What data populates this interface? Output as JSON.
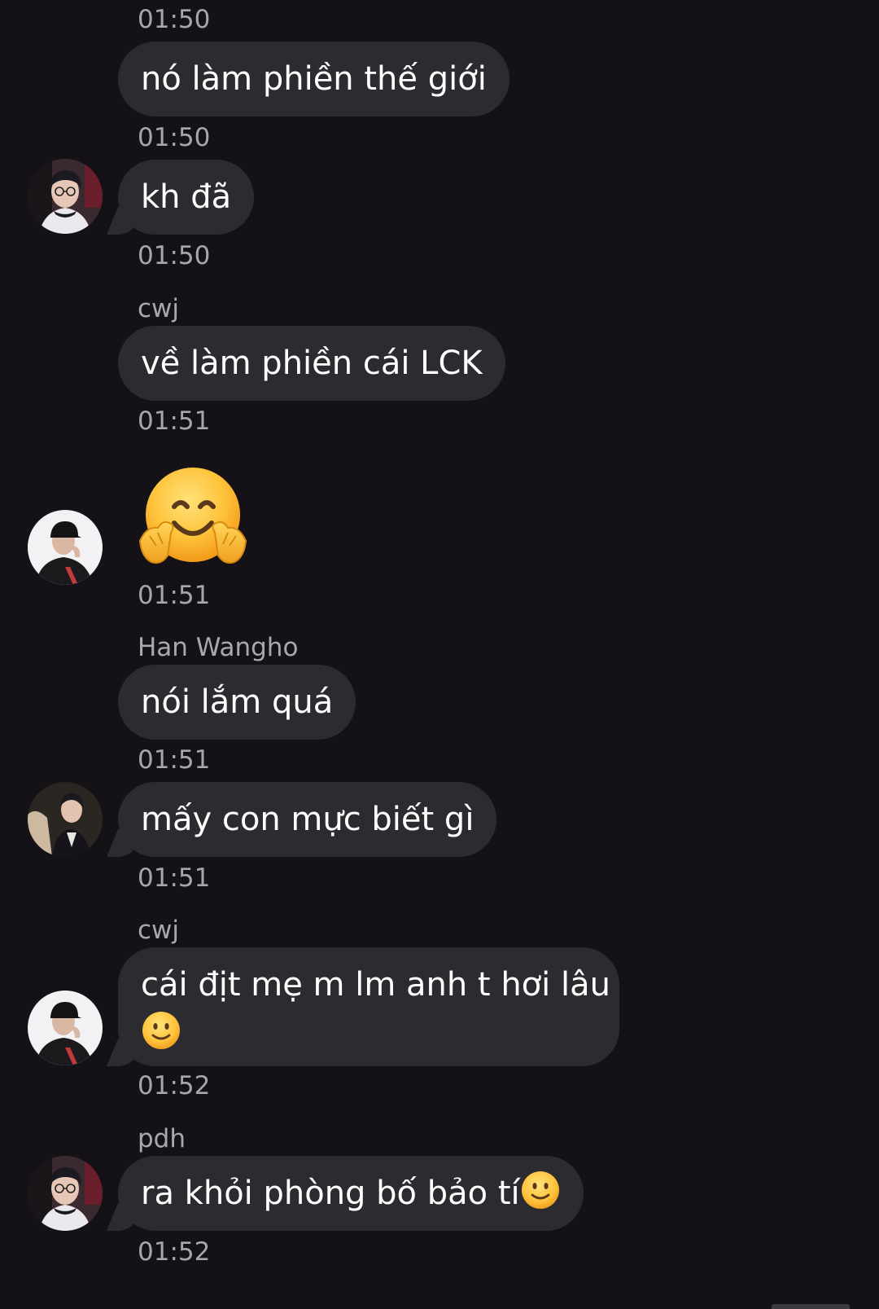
{
  "messages": [
    {
      "time": "01:50"
    },
    {
      "text": "nó làm phiền thế giới",
      "time": "01:50"
    },
    {
      "text": "kh đã",
      "time": "01:50",
      "avatar": "avatar-glasses"
    },
    {
      "sender": "cwj",
      "text": "về làm phiền cái LCK",
      "time": "01:51"
    },
    {
      "emoji": "hugging-face-emoji",
      "time": "01:51",
      "avatar": "avatar-cap"
    },
    {
      "sender": "Han Wangho",
      "text": "nói lắm quá",
      "time": "01:51"
    },
    {
      "text": "mấy con mực biết gì",
      "time": "01:51",
      "avatar": "avatar-suit"
    },
    {
      "sender": "cwj",
      "text_line1": "cái địt mẹ m lm anh t hơi lâu",
      "inline_emoji": "slightly-smiling-face-emoji",
      "time": "01:52",
      "avatar": "avatar-cap"
    },
    {
      "sender": "pdh",
      "text": "ra khỏi phòng bố bảo tí",
      "inline_emoji": "slightly-smiling-face-emoji",
      "time": "01:52",
      "avatar": "avatar-glasses"
    }
  ],
  "colors": {
    "background": "#141217",
    "bubble": "#2c2b30",
    "timestamp": "#a7a6ab",
    "message_text": "#ffffff"
  }
}
